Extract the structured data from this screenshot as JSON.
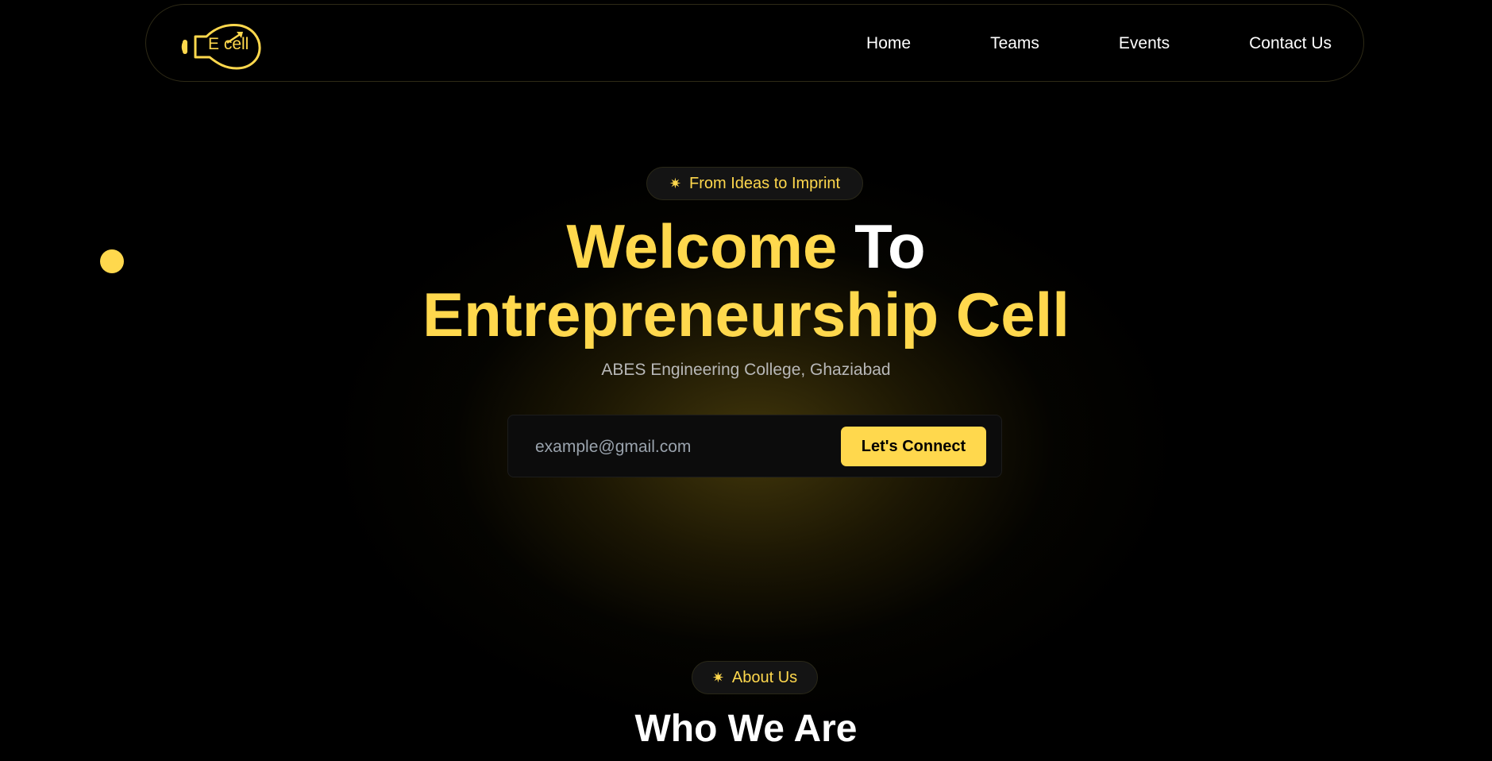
{
  "nav": {
    "logo_text": "E cell",
    "links": [
      "Home",
      "Teams",
      "Events",
      "Contact Us"
    ]
  },
  "hero": {
    "badge_icon": "sparkle-icon",
    "badge_text": "From Ideas to Imprint",
    "title_part1": "Welcome",
    "title_part2": "To",
    "title_line2": "Entrepreneurship Cell",
    "subtitle": "ABES Engineering College, Ghaziabad",
    "email_placeholder": "example@gmail.com",
    "connect_label": "Let's Connect"
  },
  "about": {
    "badge_icon": "sparkle-icon",
    "badge_text": "About Us",
    "title": "Who We Are"
  },
  "colors": {
    "accent": "#ffd84d",
    "background": "#000000",
    "text": "#ffffff",
    "muted": "#b8b8b8"
  }
}
